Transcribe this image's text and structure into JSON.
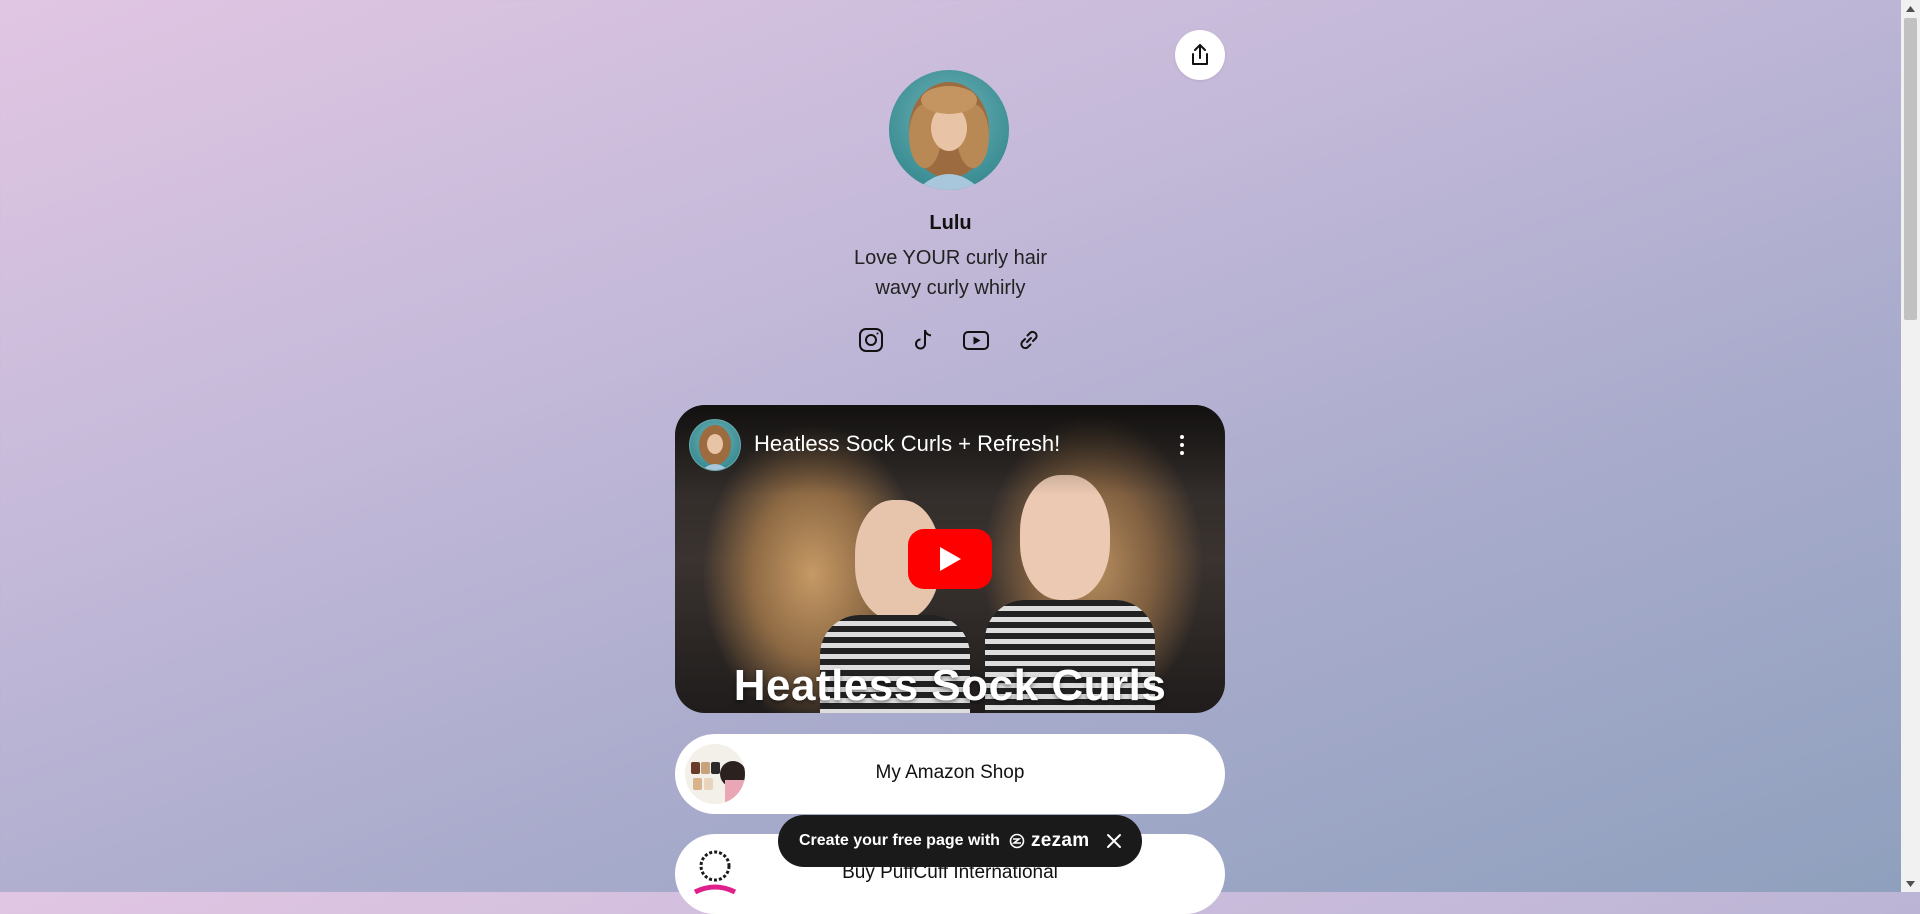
{
  "profile": {
    "name": "Lulu",
    "bio_line1": "Love YOUR curly hair",
    "bio_line2": "wavy curly whirly",
    "avatar_icon": "profile-photo"
  },
  "header": {
    "share_icon": "share-icon"
  },
  "socials": [
    {
      "platform": "Instagram",
      "icon": "instagram-icon"
    },
    {
      "platform": "TikTok",
      "icon": "tiktok-icon"
    },
    {
      "platform": "YouTube",
      "icon": "youtube-icon"
    },
    {
      "platform": "Link",
      "icon": "link-icon"
    }
  ],
  "video": {
    "title": "Heatless Sock Curls + Refresh!",
    "thumbnail_caption": "Heatless Sock Curls",
    "play_color": "#ff0000"
  },
  "links": [
    {
      "label": "My Amazon Shop"
    },
    {
      "label": "Buy PuffCuff International"
    }
  ],
  "banner": {
    "text": "Create your free page with",
    "brand": "zezam"
  },
  "colors": {
    "gradient_start": "#e1c6e3",
    "gradient_end": "#8ea0bd",
    "card_bg": "#ffffff",
    "banner_bg": "#1a1a1a"
  }
}
